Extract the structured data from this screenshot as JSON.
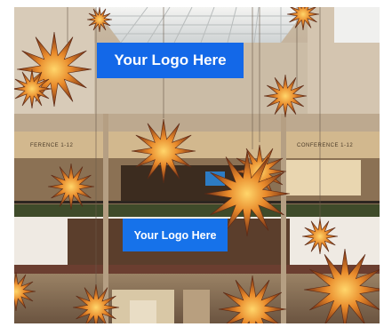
{
  "logos": {
    "top": "Your Logo Here",
    "bottom": "Your Logo Here"
  },
  "signs": {
    "left": "FERENCE 1-12",
    "right": "CONFERENCE 1-12"
  },
  "colors": {
    "logo_background": "#1368e8",
    "logo_text": "#ffffff",
    "star_glow": "#e8892a"
  }
}
